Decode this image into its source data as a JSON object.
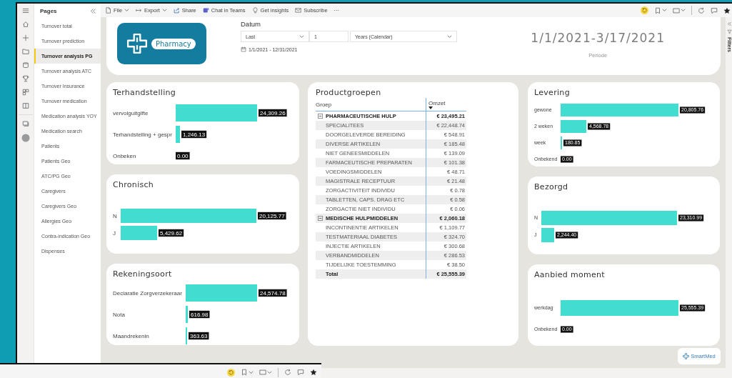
{
  "toolbar": {
    "items": [
      {
        "label": "File",
        "kind": "dropdown"
      },
      {
        "label": "Export",
        "kind": "dropdown"
      },
      {
        "label": "Share",
        "kind": "button"
      },
      {
        "label": "Chat in Teams",
        "kind": "button"
      },
      {
        "label": "Get insights",
        "kind": "button"
      },
      {
        "label": "Subscribe",
        "kind": "button"
      }
    ],
    "more": "···"
  },
  "pages": {
    "title": "Pages",
    "items": [
      {
        "label": "Turnover total",
        "selected": false
      },
      {
        "label": "Turnover prediction",
        "selected": false
      },
      {
        "label": "Turnover analysis PG",
        "selected": true
      },
      {
        "label": "Turnover analysis ATC",
        "selected": false
      },
      {
        "label": "Turnover Insurance",
        "selected": false
      },
      {
        "label": "Turnover medication",
        "selected": false
      },
      {
        "label": "Medication analysis YOY",
        "selected": false
      },
      {
        "label": "Medication search",
        "selected": false
      },
      {
        "label": "Patients",
        "selected": false
      },
      {
        "label": "Patients Geo",
        "selected": false
      },
      {
        "label": "ATC/PG Geo",
        "selected": false
      },
      {
        "label": "Caregivers",
        "selected": false
      },
      {
        "label": "Caregivers Geo",
        "selected": false
      },
      {
        "label": "Allergies Geo",
        "selected": false
      },
      {
        "label": "Contra-indication Geo",
        "selected": false
      },
      {
        "label": "Dispenses",
        "selected": false
      }
    ]
  },
  "header": {
    "logo_text": "Pharmacy",
    "slicer": {
      "title": "Datum",
      "mode": "Last",
      "count": "1",
      "unit": "Years (Calendar)",
      "range": "1/1/2021 - 12/31/2021"
    },
    "period": {
      "value": "1/1/2021-3/17/2021",
      "label": "Periode"
    }
  },
  "left_column": [
    {
      "chart_data": {
        "type": "bar",
        "orientation": "horizontal",
        "title": "Terhandstelling",
        "categories": [
          "vervolguitgifte",
          "Terhandstelling + gespr",
          "Onbeken"
        ],
        "values": [
          24309.26,
          1246.13,
          0.0
        ],
        "value_labels": [
          "24,309.26",
          "1,246.13",
          "0.00"
        ]
      }
    },
    {
      "chart_data": {
        "type": "bar",
        "orientation": "horizontal",
        "title": "Chronisch",
        "categories": [
          "N",
          "J"
        ],
        "values": [
          20125.77,
          5429.62
        ],
        "value_labels": [
          "20,125.77",
          "5,429.62"
        ]
      }
    },
    {
      "chart_data": {
        "type": "bar",
        "orientation": "horizontal",
        "title": "Rekeningsoort",
        "categories": [
          "Declaratie Zorgverzekeraar",
          "Nota",
          "Maandrekenin"
        ],
        "values": [
          24574.78,
          616.98,
          363.63
        ],
        "value_labels": [
          "24,574.78",
          "616.98",
          "363.63"
        ]
      }
    }
  ],
  "table": {
    "title": "Productgroepen",
    "columns": [
      "Groep",
      "Omzet"
    ],
    "groups": [
      {
        "name": "PHARMACEUTISCHE HULP",
        "value": "€ 23,495.21",
        "expanded": true,
        "children": [
          {
            "name": "SPECIALITEES",
            "value": "€ 22,448.74"
          },
          {
            "name": "DOORGELEVERDE BEREIDING",
            "value": "€ 548.91"
          },
          {
            "name": "DIVERSE ARTIKELEN",
            "value": "€ 185.48"
          },
          {
            "name": "NIET GENEESMIDDELEN",
            "value": "€ 139.09"
          },
          {
            "name": "FARMACEUTISCHE PREPARATEN",
            "value": "€ 101.38"
          },
          {
            "name": "VOEDINGSMIDDELEN",
            "value": "€ 48.71"
          },
          {
            "name": "MAGISTRALE RECEPTUUR",
            "value": "€ 21.48"
          },
          {
            "name": "ZORGACTIVITEIT INDIVIDU",
            "value": "€ 0.78"
          },
          {
            "name": "TABLETTEN, CAPS. DRAG ETC",
            "value": "€ 0.58"
          },
          {
            "name": "ZORGACTIE NIET INDIVIDU",
            "value": "€ 0.06"
          }
        ]
      },
      {
        "name": "MEDISCHE HULPMIDDELEN",
        "value": "€ 2,060.18",
        "expanded": true,
        "children": [
          {
            "name": "INCONTINENTIE ARTIKELEN",
            "value": "€ 1,109.77"
          },
          {
            "name": "TESTMATERIAAL DIABETES",
            "value": "€ 324.70"
          },
          {
            "name": "INJECTIE ARTIKELEN",
            "value": "€ 300.68"
          },
          {
            "name": "VERBANDMIDDELEN",
            "value": "€ 286.53"
          },
          {
            "name": "TIJDELIJKE TOESTEMMING",
            "value": "€ 38.50"
          }
        ]
      }
    ],
    "total": {
      "label": "Total",
      "value": "€ 25,555.39"
    }
  },
  "right_column": [
    {
      "chart_data": {
        "type": "bar",
        "orientation": "horizontal",
        "title": "Levering",
        "categories": [
          "gewone",
          "2 weken",
          "week",
          "Onbekend"
        ],
        "values": [
          20805.76,
          4568.78,
          180.85,
          0.0
        ],
        "value_labels": [
          "20,805.76",
          "4,568.78",
          "180.85",
          "0.00"
        ]
      }
    },
    {
      "chart_data": {
        "type": "bar",
        "orientation": "horizontal",
        "title": "Bezorgd",
        "categories": [
          "N",
          "J"
        ],
        "values": [
          23310.99,
          2244.4
        ],
        "value_labels": [
          "23,310.99",
          "2,244.40"
        ]
      }
    },
    {
      "chart_data": {
        "type": "bar",
        "orientation": "horizontal",
        "title": "Aanbied moment",
        "categories": [
          "werkdag",
          "Onbekend"
        ],
        "values": [
          25555.39,
          0.0
        ],
        "value_labels": [
          "25,555.39",
          "0.00"
        ]
      }
    }
  ],
  "brand": {
    "text": "SmartMed"
  },
  "filters": {
    "label": "Filters"
  }
}
